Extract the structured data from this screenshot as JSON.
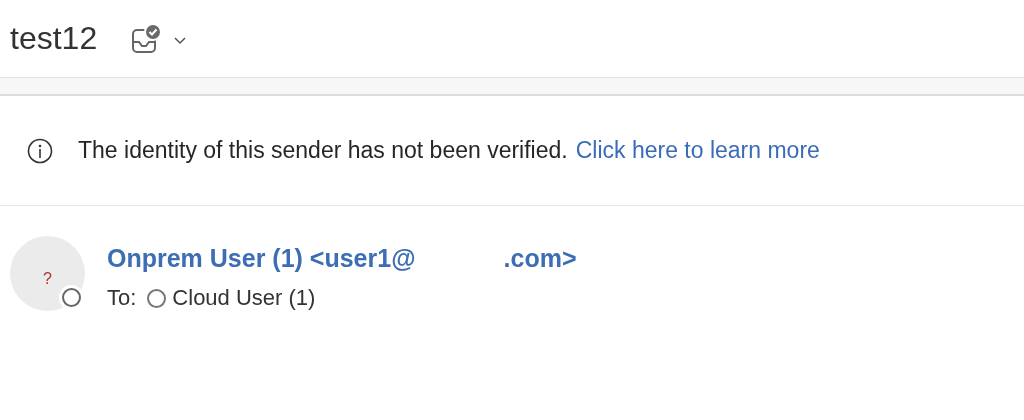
{
  "header": {
    "title": "test12"
  },
  "info_bar": {
    "message": "The identity of this sender has not been verified.",
    "link": "Click here to learn more"
  },
  "message": {
    "avatar": "?",
    "sender": "Onprem User (1) <user1@",
    "sender_end": ".com>",
    "to_label": "To:",
    "recipients": [
      "Cloud User (1)"
    ]
  }
}
